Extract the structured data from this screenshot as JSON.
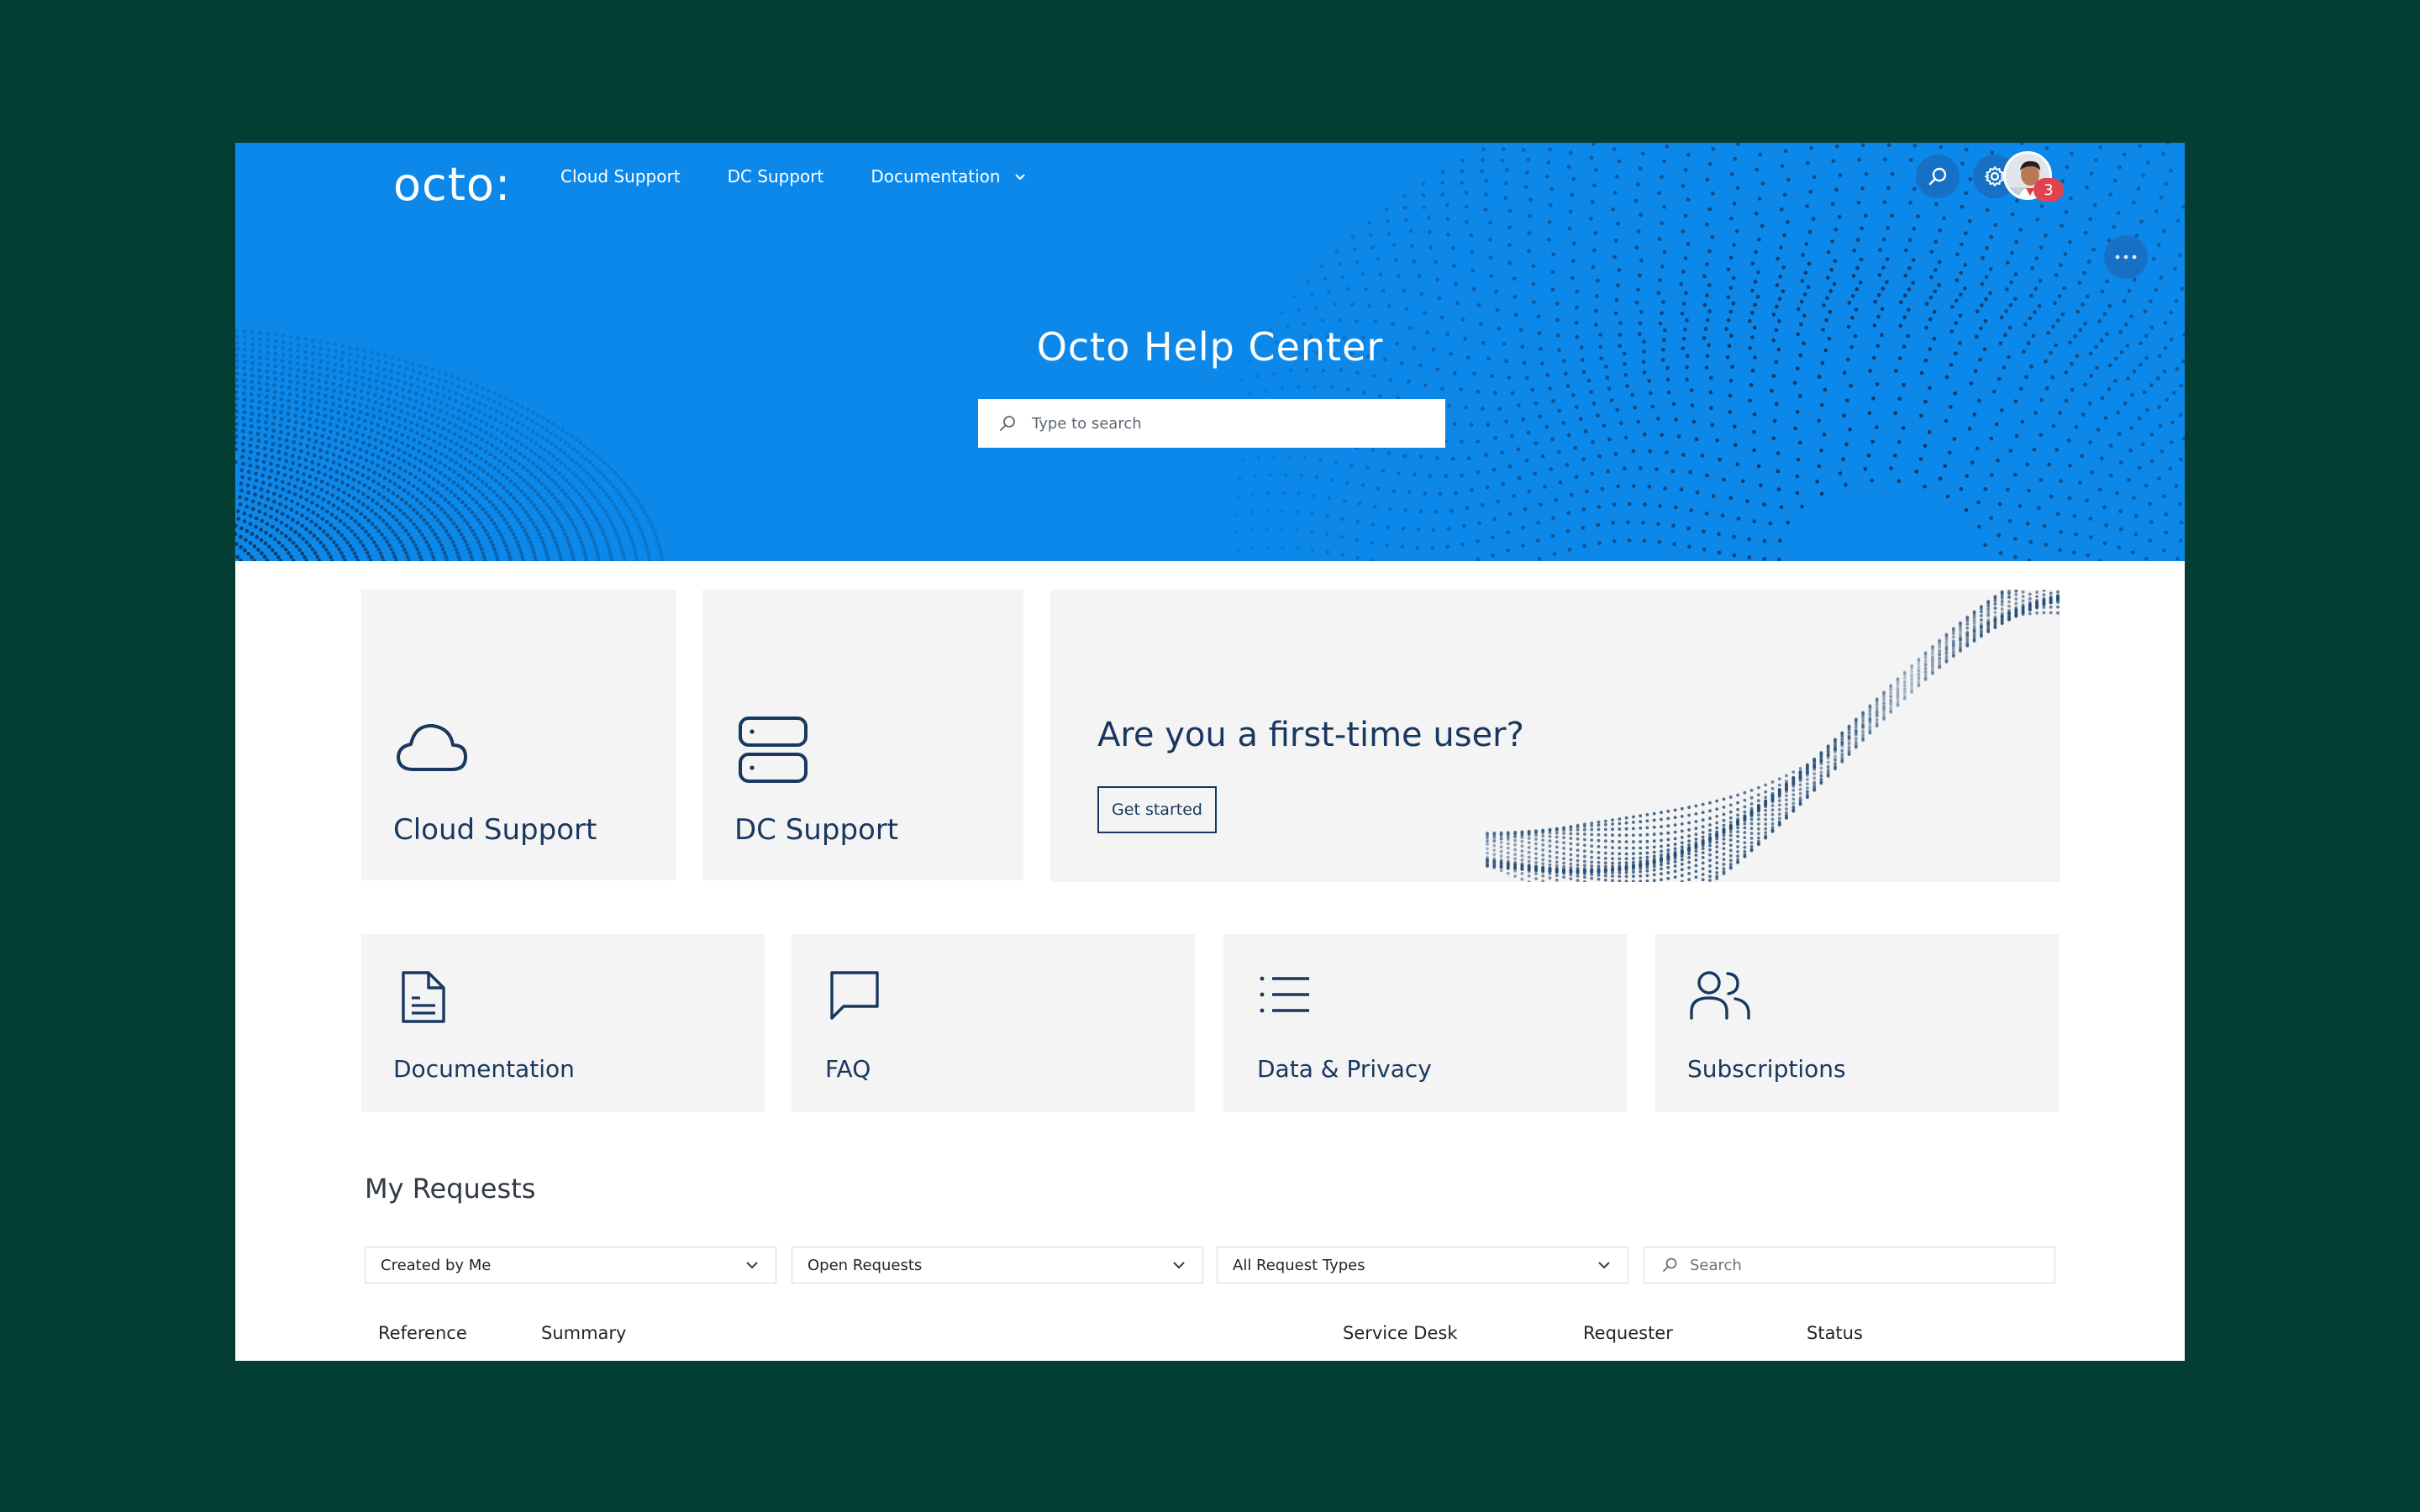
{
  "header": {
    "logo": "octo:",
    "nav": {
      "cloud_support": "Cloud Support",
      "dc_support": "DC Support",
      "documentation": "Documentation"
    },
    "notification_count": "3"
  },
  "hero": {
    "title": "Octo Help Center",
    "search_placeholder": "Type to search"
  },
  "cards": {
    "cloud_support": "Cloud Support",
    "dc_support": "DC Support",
    "first_time": {
      "title": "Are you a first-time user?",
      "button": "Get started"
    },
    "documentation": "Documentation",
    "faq": "FAQ",
    "data_privacy": "Data & Privacy",
    "subscriptions": "Subscriptions"
  },
  "requests": {
    "title": "My Requests",
    "filters": {
      "created_by": "Created by Me",
      "status": "Open Requests",
      "types": "All Request Types",
      "search_placeholder": "Search"
    },
    "columns": {
      "reference": "Reference",
      "summary": "Summary",
      "service_desk": "Service Desk",
      "requester": "Requester",
      "status": "Status"
    }
  },
  "colors": {
    "background": "#033d34",
    "hero_blue": "#0b88ea",
    "navy": "#18385f",
    "card_grey": "#f4f4f4",
    "badge_red": "#e0434d"
  }
}
